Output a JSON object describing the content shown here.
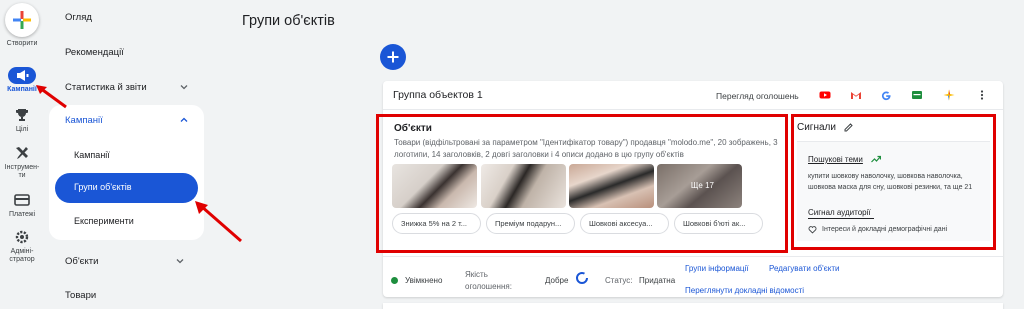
{
  "rail": {
    "create_label": "Створити",
    "campaigns_label": "Кампанії",
    "goals_label": "Цілі",
    "tools_label_1": "Інструмен-",
    "tools_label_2": "ти",
    "billing_label": "Платежі",
    "admin_label_1": "Адміні-",
    "admin_label_2": "стратор"
  },
  "nav": {
    "overview": "Огляд",
    "recommendations": "Рекомендації",
    "stats": "Статистика й звіти",
    "campaigns_section": "Кампанії",
    "sub_campaigns": "Кампанії",
    "sub_asset_groups": "Групи об'єктів",
    "sub_experiments": "Експерименти",
    "assets": "Об'єкти",
    "products": "Товари"
  },
  "main": {
    "title": "Групи об'єктів",
    "card": {
      "title": "Группа объектов 1",
      "preview_label": "Перегляд оголошень",
      "channels": [
        "youtube-icon",
        "gmail-icon",
        "google-icon",
        "display-icon",
        "discover-icon",
        "more-vert-icon"
      ],
      "assets_title": "Об'єкти",
      "assets_desc": "Товари (відфільтровані за параметром \"Ідентифікатор товару\") продавця \"molodo.me\", 20 зображень, 3 логотипи, 14 заголовків, 2 довгі заголовки і 4 описи додано в цю групу об'єктів",
      "more_images": "Ще 17",
      "chips": [
        "Знижка 5% на 2 т...",
        "Преміум подарун...",
        "Шовкові аксесуа...",
        "Шовкові б'юті ак..."
      ],
      "signals_title": "Сигнали",
      "search_themes_label": "Пошукові теми",
      "search_themes_text": "купити шовкову наволочку, шовкова наволочка, шовкова маска для сну, шовкові резинки, та ще 21",
      "audience_label": "Сигнал аудиторії",
      "audience_text": "Інтереси й докладні демографічні дані"
    },
    "status": {
      "enabled": "Увімкнено",
      "quality_label_1": "Якість",
      "quality_label_2": "оголошення:",
      "quality_value": "Добре",
      "status_label": "Статус:",
      "status_value": "Придатна",
      "link_info_groups": "Групи інформації",
      "link_edit_assets": "Редагувати об'єкти",
      "link_details": "Переглянути докладні відомості"
    }
  },
  "colors": {
    "accent": "#1a56d6",
    "annotation": "#e00000",
    "status_green": "#1e8e3e"
  }
}
